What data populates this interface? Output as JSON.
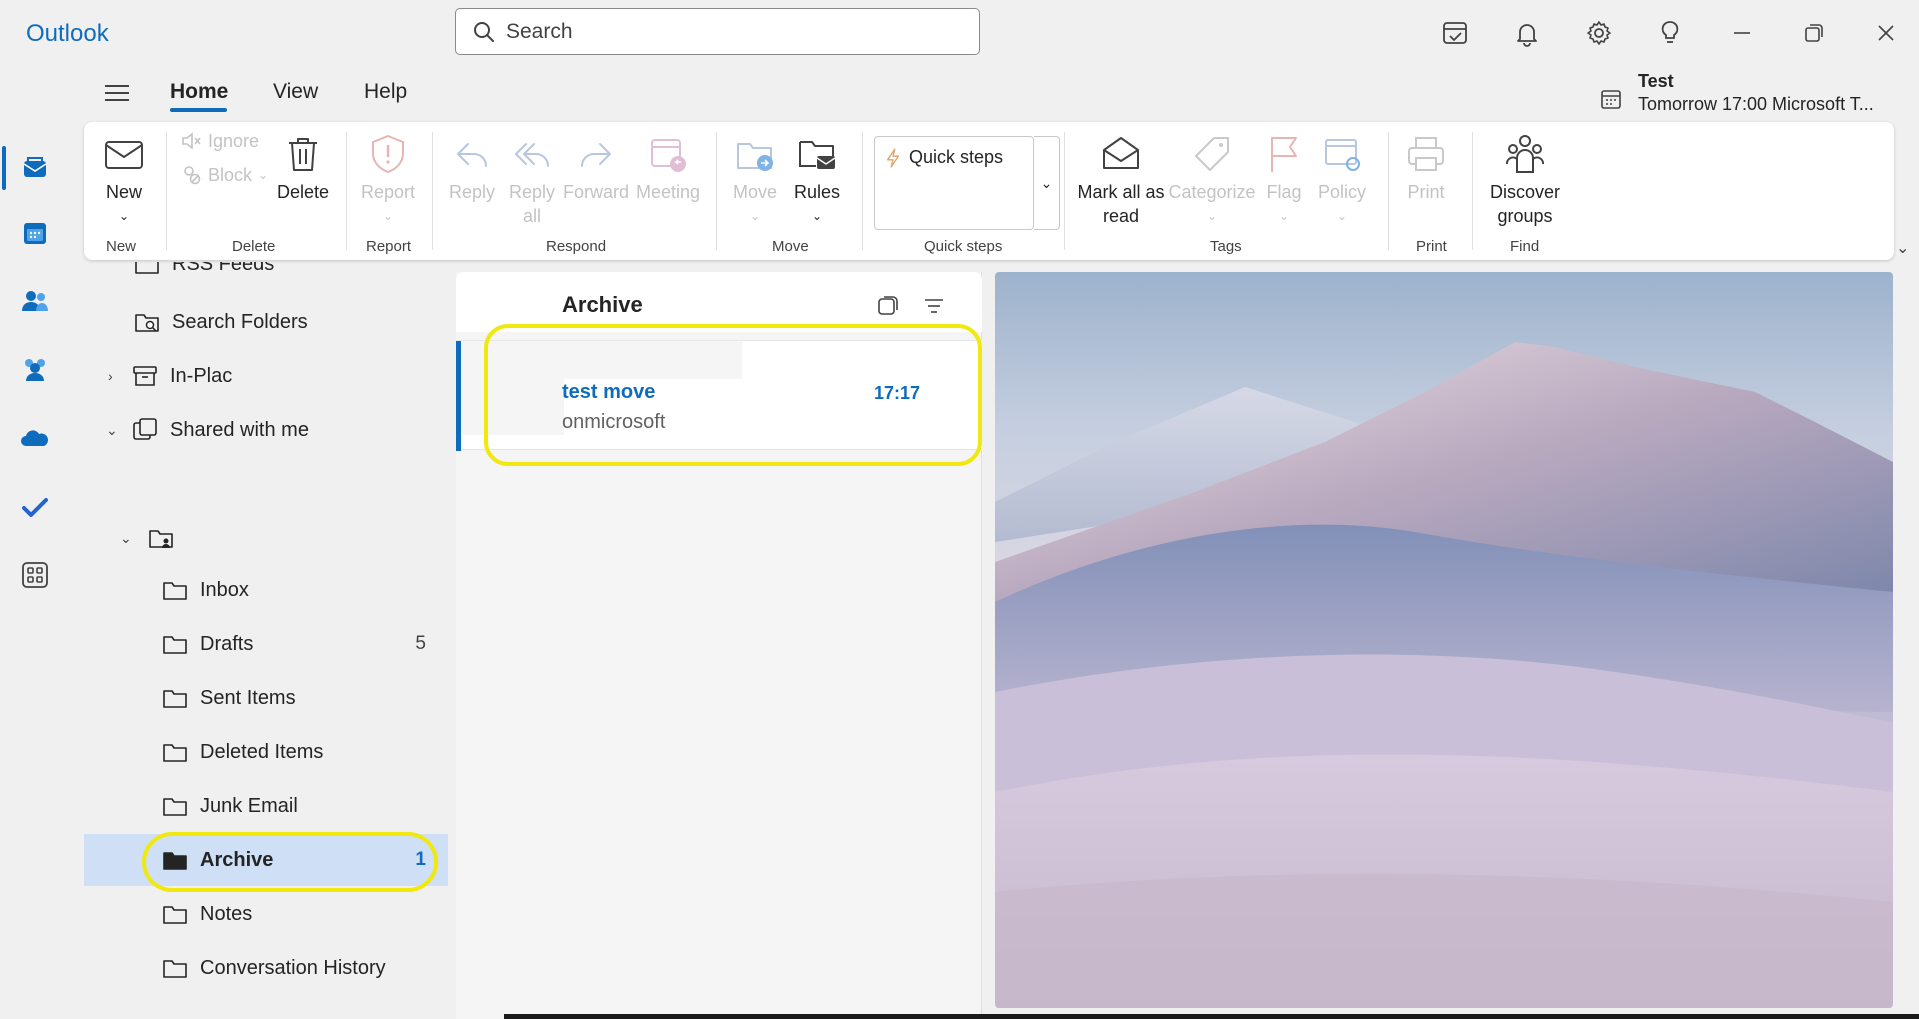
{
  "app": {
    "name": "Outlook"
  },
  "search": {
    "placeholder": "Search"
  },
  "titlebar_icons": [
    "my-day-icon",
    "bell-icon",
    "gear-icon",
    "lightbulb-icon",
    "minimize-icon",
    "restore-icon",
    "close-icon"
  ],
  "rail": [
    "mail-icon",
    "calendar-icon",
    "people-icon",
    "groups-icon",
    "onedrive-icon",
    "todo-icon",
    "apps-icon"
  ],
  "tabs": [
    {
      "label": "Home",
      "active": true
    },
    {
      "label": "View",
      "active": false
    },
    {
      "label": "Help",
      "active": false
    }
  ],
  "reminder": {
    "title": "Test",
    "subtitle": "Tomorrow 17:00 Microsoft T..."
  },
  "ribbon": {
    "new": {
      "label": "New",
      "group": "New"
    },
    "ignore": "Ignore",
    "block": "Block",
    "delete": {
      "label": "Delete",
      "group": "Delete"
    },
    "report": {
      "label": "Report",
      "group": "Report"
    },
    "respond": {
      "group": "Respond",
      "reply": "Reply",
      "reply_all_1": "Reply",
      "reply_all_2": "all",
      "forward": "Forward",
      "meeting": "Meeting"
    },
    "move": {
      "group": "Move",
      "move": "Move",
      "rules": "Rules"
    },
    "quick_steps": {
      "label": "Quick steps",
      "group": "Quick steps"
    },
    "tags": {
      "group": "Tags",
      "mark_all_1": "Mark all as",
      "mark_all_2": "read",
      "categorize": "Categorize",
      "flag": "Flag",
      "policy": "Policy"
    },
    "print": {
      "label": "Print",
      "group": "Print"
    },
    "find": {
      "label_1": "Discover",
      "label_2": "groups",
      "group": "Find"
    }
  },
  "folders": {
    "rss": "RSS Feeds",
    "search_folders": "Search Folders",
    "in_place": "In-Plac",
    "shared": "Shared with me",
    "mailbox_items": [
      {
        "label": "Inbox",
        "count": ""
      },
      {
        "label": "Drafts",
        "count": "5"
      },
      {
        "label": "Sent Items",
        "count": ""
      },
      {
        "label": "Deleted Items",
        "count": ""
      },
      {
        "label": "Junk Email",
        "count": ""
      },
      {
        "label": "Archive",
        "count": "1",
        "selected": true
      },
      {
        "label": "Notes",
        "count": ""
      },
      {
        "label": "Conversation History",
        "count": ""
      }
    ]
  },
  "message_list": {
    "title": "Archive",
    "messages": [
      {
        "subject": "test move",
        "time": "17:17",
        "preview": "onmicrosoft",
        "unread": true
      }
    ]
  },
  "colors": {
    "accent": "#0f6cbd",
    "highlight": "#f0e80f",
    "selected_folder": "#cfe0f6"
  }
}
